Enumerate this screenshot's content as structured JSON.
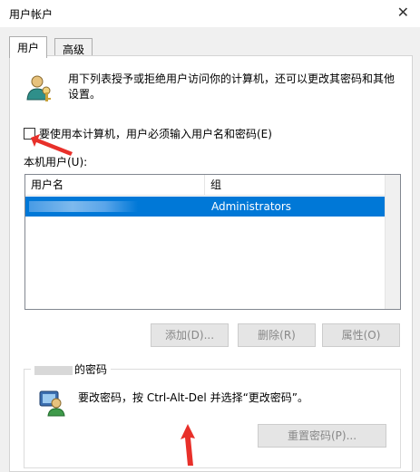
{
  "window": {
    "title": "用户帐户"
  },
  "tabs": [
    {
      "label": "用户"
    },
    {
      "label": "高级"
    }
  ],
  "description": "用下列表授予或拒绝用户访问你的计算机，还可以更改其密码和其他设置。",
  "checkbox": {
    "label": "要使用本计算机，用户必须输入用户名和密码(E)",
    "checked": false
  },
  "users_section": {
    "label": "本机用户(U):"
  },
  "table": {
    "columns": [
      "用户名",
      "组"
    ],
    "rows": [
      {
        "user": "",
        "group": "Administrators",
        "selected": true
      }
    ]
  },
  "buttons": {
    "add": "添加(D)...",
    "remove": "删除(R)",
    "properties": "属性(O)"
  },
  "password_group": {
    "title_suffix": "的密码",
    "text": "要改密码，按 Ctrl-Alt-Del 并选择“更改密码”。",
    "reset_button": "重置密码(P)..."
  },
  "colors": {
    "selection": "#0078d7",
    "annotation_arrow": "#e8302a"
  }
}
